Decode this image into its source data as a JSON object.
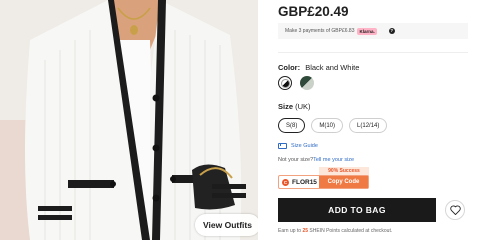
{
  "product": {
    "image_alt_icon": "cardigan-photo",
    "view_outfits_label": "View Outfits"
  },
  "price": {
    "amount": "GBP£20.49",
    "installment_text": "Make 3 payments of GBP£6.83",
    "installment_provider": "Klarna."
  },
  "color": {
    "label": "Color:",
    "selected": "Black and White",
    "swatches": [
      "Black and White",
      "Dark Green"
    ]
  },
  "size": {
    "label": "Size",
    "unit": "(UK)",
    "options": [
      "S(8)",
      "M(10)",
      "L(12/14)"
    ],
    "selected": "S(8)",
    "guide_label": "Size Guide",
    "fit_question": "Not your size?",
    "fit_link": "Tell me your size"
  },
  "coupon": {
    "success_rate": "90% Success",
    "code": "FLOR15",
    "copy_label": "Copy Code"
  },
  "actions": {
    "add_to_bag": "ADD TO BAG"
  },
  "points": {
    "prefix": "Earn up to",
    "amount": "25",
    "suffix": "SHEIN Points calculated at checkout."
  },
  "colors": {
    "accent_orange": "#f07a43",
    "button_dark": "#1a1a1a",
    "link_blue": "#2f6bc4",
    "klarna_pink": "#ffb3c7"
  }
}
